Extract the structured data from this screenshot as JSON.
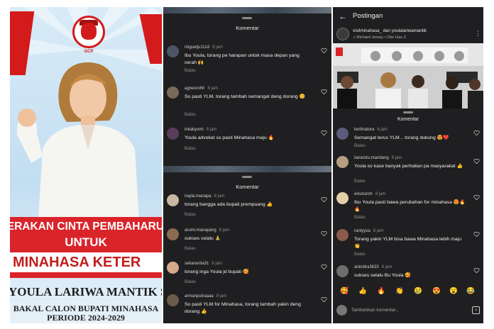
{
  "poster": {
    "logo_text": "GCP",
    "banner_line1": "ERAKAN CINTA PEMBAHARUA",
    "banner_line2": "UNTUK",
    "banner_line3": "MINAHASA KETER",
    "candidate_name": "YOULA LARIWA MANTIK SH.,M",
    "subtitle_line1": "BAKAL CALON BUPATI MINAHASA",
    "subtitle_line2": "PERIODE 2024-2029"
  },
  "panel_a": {
    "title": "Komentar",
    "comments": [
      {
        "user": "miguelju11o3",
        "time": "8 jam",
        "text": "Ibu Youla, torang pe harapan untuk masa depan yang cerah 🙌",
        "reply": "Balas"
      },
      {
        "user": "agnesrohh",
        "time": "8 jam",
        "text": "So pasti YLM, torang tambah semangat deng dorang 😊",
        "reply": "Balas"
      },
      {
        "user": "inkakyomi",
        "time": "8 jam",
        "text": "Youla advokat so pasti Minahasa maju 🔥",
        "reply": "Balas"
      }
    ]
  },
  "panel_b": {
    "title": "Komentar",
    "comments": [
      {
        "user": "nayla.manapa",
        "time": "8 jam",
        "text": "torang bangga ada bupati prempuang 👍",
        "reply": "Balas"
      },
      {
        "user": "arumi.manayang",
        "time": "8 jam",
        "text": "sukses selalu 🙏",
        "reply": "Balas"
      },
      {
        "user": "sekaranita31",
        "time": "8 jam",
        "text": "torang inga Youla jd bupati 🥰",
        "reply": "Balas"
      },
      {
        "user": "armanputraaaa",
        "time": "8 jam",
        "text": "So pasti YLM for Minahasa, torang tambah yakin deng dorang 👍",
        "reply": "Balas"
      }
    ]
  },
  "panel_c": {
    "header_title": "Postingan",
    "back_icon": "←",
    "author_line": "visitminahasa_ dan youlalariwamantik",
    "music_line": "♫ Richard Jersey • Oke Gas 2",
    "more_icon": "⋮",
    "sheet_title": "Komentar",
    "comments": [
      {
        "user": "kertinatora",
        "time": "8 jam",
        "text": "Semangat terus YLM... torang dukung 😍❤️",
        "reply": "Balas"
      },
      {
        "user": "tiararotu.mandang",
        "time": "8 jam",
        "text": "Youla so kase banyak perhatian pa masyarakat 👍",
        "reply": "Balas"
      },
      {
        "user": "elissturoh",
        "time": "8 jam",
        "text": "Ibu Youla pasti bawa perubahan for minahasa 😍🔥🔥",
        "reply": "Balas"
      },
      {
        "user": "rantyysa",
        "time": "8 jam",
        "text": "Torang yakin YLM bisa bawa Minahasa lebih maju 👏",
        "reply": "Balas"
      },
      {
        "user": "anindira3633",
        "time": "8 jam",
        "text": "sukses selalu Bu Youla 🥰",
        "reply": ""
      }
    ],
    "emojis": [
      "🥰",
      "👍",
      "🔥",
      "👏",
      "😢",
      "😍",
      "😮",
      "😂"
    ],
    "input_placeholder": "Tambahkan komentar..."
  },
  "colors": {
    "brand_red": "#d9242a",
    "dark_bg": "#1f1f21",
    "muted_text": "#8f8f8f"
  }
}
